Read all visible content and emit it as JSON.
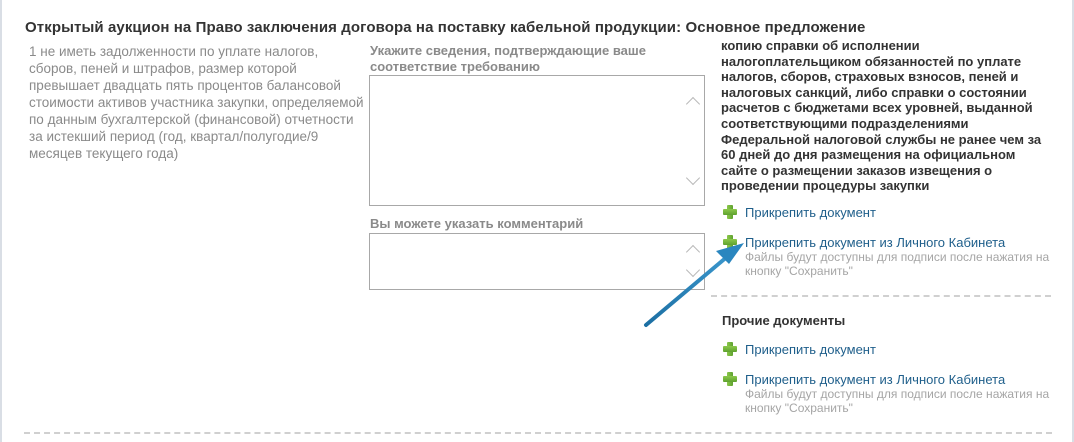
{
  "section": {
    "title": "Открытый аукцион на Право заключения договора на поставку кабельной продукции: Основное предложение"
  },
  "requirement": {
    "text": "1 не иметь задолженности по уплате налогов, сборов, пеней и штрафов, размер которой превышает двадцать пять процентов балансовой стоимости активов участника закупки, определяемой по данным бухгалтерской (финансовой) отчетности за истекший период (год, квартал/полугодие/9 месяцев текущего года)"
  },
  "fields": {
    "evidence_label": "Укажите сведения, подтверждающие ваше соответствие требованию",
    "evidence_value": "",
    "comment_label": "Вы можете указать комментарий",
    "comment_value": ""
  },
  "documents_hint": "копию справки об исполнении налогоплательщиком обязанностей по уплате налогов, сборов, страховых взносов, пеней и налоговых санкций, либо справки о состоянии расчетов с бюджетами всех уровней, выданной соответствующими подразделениями Федеральной налоговой службы не ранее чем за 60 дней до дня размещения на официальном сайте о размещении заказов извещения о проведении процедуры закупки",
  "attach": {
    "attach_document": "Прикрепить документ",
    "attach_from_cabinet": "Прикрепить документ из Личного Кабинета",
    "signature_note": "Файлы будут доступны для подписи после нажатия на кнопку \"Сохранить\""
  },
  "other_documents": {
    "title": "Прочие документы",
    "attach_document": "Прикрепить документ",
    "attach_from_cabinet": "Прикрепить документ из Личного Кабинета",
    "signature_note": "Файлы будут доступны для подписи после нажатия на кнопку \"Сохранить\""
  },
  "colors": {
    "link": "#1f5f8b",
    "plus_icon": "#6db33f",
    "annotation_arrow": "#2a7fb5"
  },
  "icons": [
    "plus-icon",
    "chevron-up-icon",
    "chevron-down-icon",
    "annotation-arrow"
  ]
}
